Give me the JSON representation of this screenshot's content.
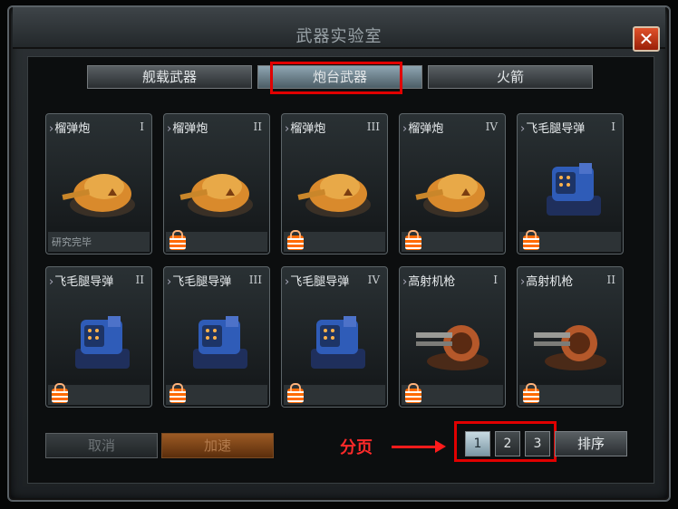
{
  "window": {
    "title": "武器实验室",
    "close_label": "✕"
  },
  "tabs": [
    {
      "label": "舰载武器",
      "active": false
    },
    {
      "label": "炮台武器",
      "active": true
    },
    {
      "label": "火箭",
      "active": false
    }
  ],
  "cards": [
    {
      "name": "榴弹炮",
      "tier": "I",
      "status": "研究完毕",
      "locked": false,
      "icon": "howitzer-turret-icon",
      "color": "#d98a2c"
    },
    {
      "name": "榴弹炮",
      "tier": "II",
      "status": "",
      "locked": true,
      "icon": "howitzer-turret-icon",
      "color": "#d98a2c"
    },
    {
      "name": "榴弹炮",
      "tier": "III",
      "status": "",
      "locked": true,
      "icon": "howitzer-turret-icon",
      "color": "#d98a2c"
    },
    {
      "name": "榴弹炮",
      "tier": "IV",
      "status": "",
      "locked": true,
      "icon": "howitzer-turret-icon",
      "color": "#d98a2c"
    },
    {
      "name": "飞毛腿导弹",
      "tier": "I",
      "status": "",
      "locked": true,
      "icon": "missile-launcher-icon",
      "color": "#2f5cb8"
    },
    {
      "name": "飞毛腿导弹",
      "tier": "II",
      "status": "",
      "locked": true,
      "icon": "missile-launcher-icon",
      "color": "#2f5cb8"
    },
    {
      "name": "飞毛腿导弹",
      "tier": "III",
      "status": "",
      "locked": true,
      "icon": "missile-launcher-icon",
      "color": "#2f5cb8"
    },
    {
      "name": "飞毛腿导弹",
      "tier": "IV",
      "status": "",
      "locked": true,
      "icon": "missile-launcher-icon",
      "color": "#2f5cb8"
    },
    {
      "name": "高射机枪",
      "tier": "I",
      "status": "",
      "locked": true,
      "icon": "anti-air-gun-icon",
      "color": "#b5582a"
    },
    {
      "name": "高射机枪",
      "tier": "II",
      "status": "",
      "locked": true,
      "icon": "anti-air-gun-icon",
      "color": "#b5582a"
    }
  ],
  "buttons": {
    "cancel": "取消",
    "accelerate": "加速",
    "sort": "排序"
  },
  "pagination": {
    "label": "分页",
    "pages": [
      "1",
      "2",
      "3"
    ],
    "current": "1"
  }
}
